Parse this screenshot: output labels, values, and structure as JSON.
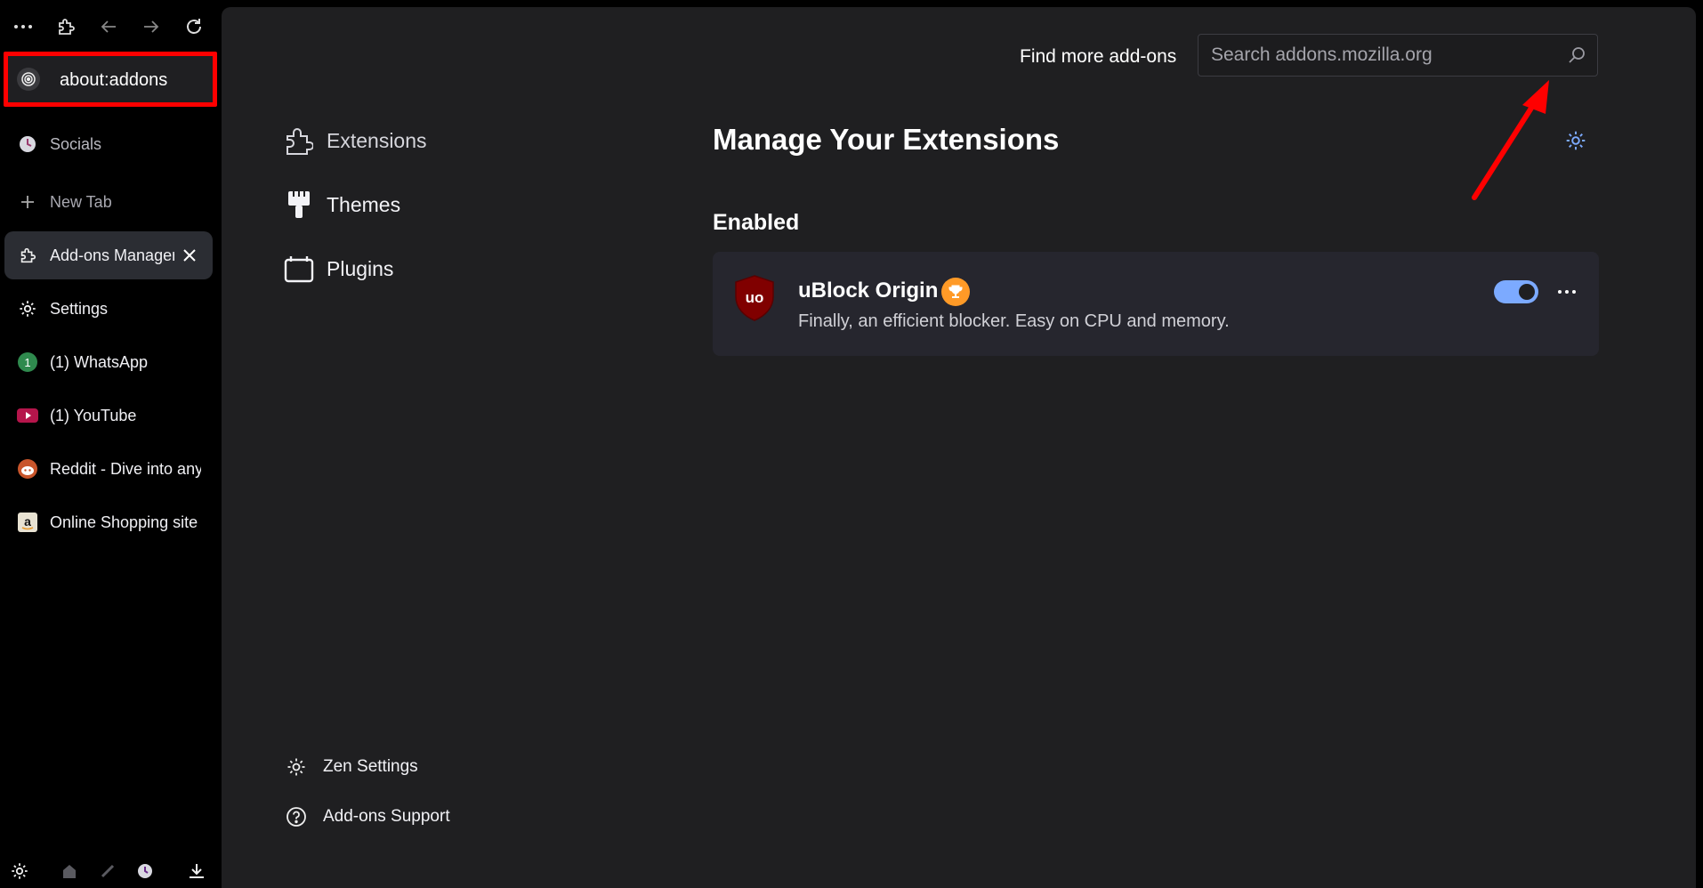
{
  "sidebar": {
    "url": "about:addons",
    "tabs": [
      {
        "label": "Socials",
        "icon": "clock-icon"
      },
      {
        "label": "New Tab",
        "icon": "plus-icon"
      },
      {
        "label": "Add-ons Manager",
        "icon": "puzzle-icon",
        "active": true
      },
      {
        "label": "Settings",
        "icon": "gear-icon"
      },
      {
        "label": "(1) WhatsApp",
        "icon": "whatsapp-icon"
      },
      {
        "label": "(1) YouTube",
        "icon": "youtube-icon"
      },
      {
        "label": "Reddit - Dive into anything",
        "icon": "reddit-icon"
      },
      {
        "label": "Online Shopping site",
        "icon": "amazon-icon"
      }
    ]
  },
  "header": {
    "find_label": "Find more add-ons",
    "search_placeholder": "Search addons.mozilla.org"
  },
  "categories": [
    {
      "label": "Extensions",
      "icon": "puzzle-icon"
    },
    {
      "label": "Themes",
      "icon": "brush-icon"
    },
    {
      "label": "Plugins",
      "icon": "plugin-icon"
    }
  ],
  "footer_links": [
    {
      "label": "Zen Settings",
      "icon": "gear-icon"
    },
    {
      "label": "Add-ons Support",
      "icon": "help-icon"
    }
  ],
  "main": {
    "title": "Manage Your Extensions",
    "section": "Enabled",
    "extension": {
      "name": "uBlock Origin",
      "description": "Finally, an efficient blocker. Easy on CPU and memory.",
      "logo_text": "uo",
      "enabled": true
    }
  },
  "colors": {
    "highlight": "#ff0000",
    "toggle": "#7caaff",
    "badge": "#ff9a27",
    "ublock_red": "#800000"
  }
}
